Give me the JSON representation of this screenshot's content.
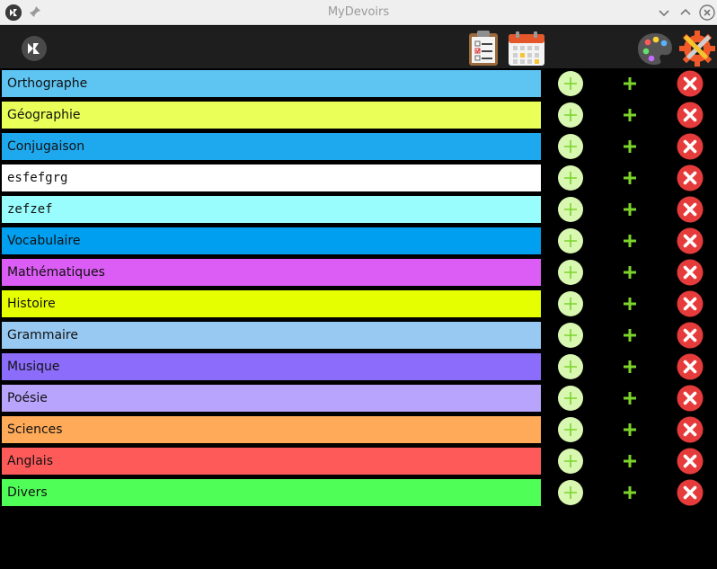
{
  "window": {
    "title": "MyDevoirs"
  },
  "toolbar": {
    "icons": [
      "kivy-logo-icon",
      "clipboard-icon",
      "calendar-icon",
      "palette-icon",
      "settings-icon"
    ]
  },
  "subjects": [
    {
      "label": "Orthographe",
      "color": "#5ec4f2"
    },
    {
      "label": "Géographie",
      "color": "#eaff58"
    },
    {
      "label": "Conjugaison",
      "color": "#1ea9ef"
    },
    {
      "label": "esfefgrg",
      "color": "#ffffff"
    },
    {
      "label": "zefzef",
      "color": "#99fdfe"
    },
    {
      "label": "Vocabulaire",
      "color": "#009ff0"
    },
    {
      "label": "Mathématiques",
      "color": "#dc5df5"
    },
    {
      "label": "Histoire",
      "color": "#e5ff00"
    },
    {
      "label": "Grammaire",
      "color": "#98c9f2"
    },
    {
      "label": "Musique",
      "color": "#8c6cfb"
    },
    {
      "label": "Poésie",
      "color": "#b8a3fd"
    },
    {
      "label": "Sciences",
      "color": "#feaa58"
    },
    {
      "label": "Anglais",
      "color": "#fe5a5a"
    },
    {
      "label": "Divers",
      "color": "#50fe58"
    }
  ],
  "colors": {
    "add_circle": "#d8f7b0",
    "add_plus": "#7cd32b",
    "delete": "#e63b3b"
  }
}
